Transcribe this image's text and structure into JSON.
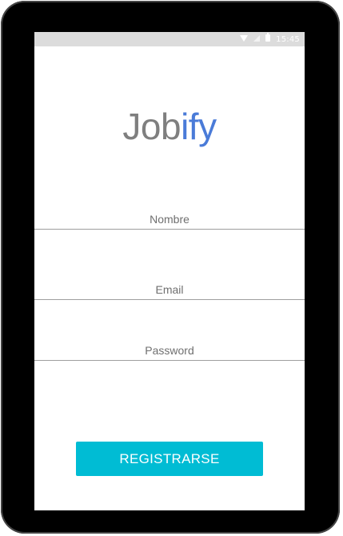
{
  "status_bar": {
    "time": "15:45",
    "icons": [
      "wifi-icon",
      "signal-icon",
      "battery-icon"
    ]
  },
  "app": {
    "logo_part_1": "Job",
    "logo_part_2": "ify"
  },
  "form": {
    "name_placeholder": "Nombre",
    "email_placeholder": "Email",
    "password_placeholder": "Password"
  },
  "actions": {
    "register_label": "REGISTRARSE"
  },
  "colors": {
    "logo_gray": "#7f7f7f",
    "logo_blue": "#4a7bd8",
    "button_accent": "#00bcd4",
    "status_bar_bg": "#dcdcdc"
  }
}
